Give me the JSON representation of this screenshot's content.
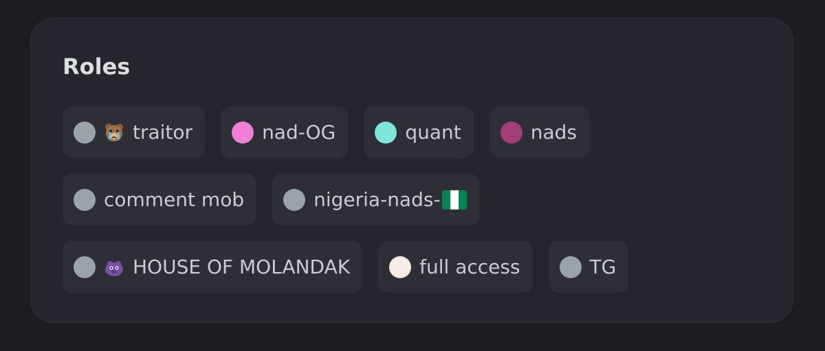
{
  "section": {
    "title": "Roles"
  },
  "roles": [
    {
      "label": "traitor",
      "dot_color": "#9aa3ab",
      "emoji": "crying-bear-icon"
    },
    {
      "label": "nad-OG",
      "dot_color": "#f07fd7"
    },
    {
      "label": "quant",
      "dot_color": "#7ee6da"
    },
    {
      "label": "nads",
      "dot_color": "#a33d78"
    },
    {
      "label": "comment mob",
      "dot_color": "#9aa3ab"
    },
    {
      "label": "nigeria-nads-",
      "dot_color": "#9aa3ab",
      "emoji": "nigeria-flag-icon"
    },
    {
      "label": "HOUSE OF MOLANDAK",
      "dot_color": "#9aa3ab",
      "emoji": "purple-creature-icon"
    },
    {
      "label": "full access",
      "dot_color": "#f7ebe6"
    },
    {
      "label": "TG",
      "dot_color": "#9aa3ab"
    }
  ]
}
